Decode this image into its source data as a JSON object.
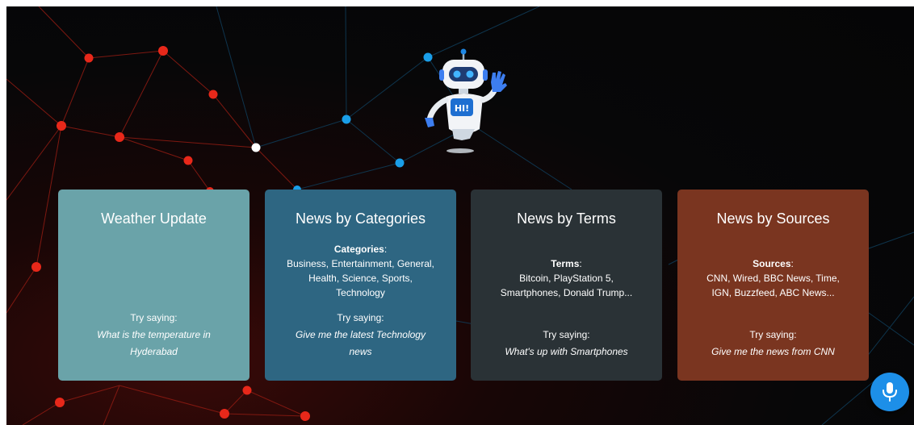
{
  "cards": [
    {
      "title": "Weather Update",
      "try_label": "Try saying:",
      "example_line1": "What is the temperature in",
      "example_line2": "Hyderabad",
      "bg": "#6aa3a9"
    },
    {
      "title": "News by Categories",
      "info_label": "Categories",
      "info_lines": [
        "Business, Entertainment, General,",
        "Health, Science, Sports,",
        "Technology"
      ],
      "try_label": "Try saying:",
      "example_line1": "Give me the latest Technology",
      "example_line2": "news",
      "bg": "#2e6682"
    },
    {
      "title": "News by Terms",
      "info_label": "Terms",
      "info_lines": [
        "Bitcoin, PlayStation 5,",
        "Smartphones, Donald Trump..."
      ],
      "try_label": "Try saying:",
      "example_line1": "What's up with Smartphones",
      "bg": "#2a3236"
    },
    {
      "title": "News by Sources",
      "info_label": "Sources",
      "info_lines": [
        "CNN, Wired, BBC News, Time,",
        "IGN, Buzzfeed, ABC News..."
      ],
      "try_label": "Try saying:",
      "example_line1": "Give me the news from CNN",
      "bg": "#7a3520"
    }
  ],
  "robot": {
    "badge_text": "HI!"
  },
  "colors": {
    "red_node": "#e8281a",
    "blue_node": "#1a9ee8",
    "mic": "#1d8fe8"
  },
  "icons": {
    "mic": "microphone-icon",
    "robot": "robot-mascot"
  }
}
